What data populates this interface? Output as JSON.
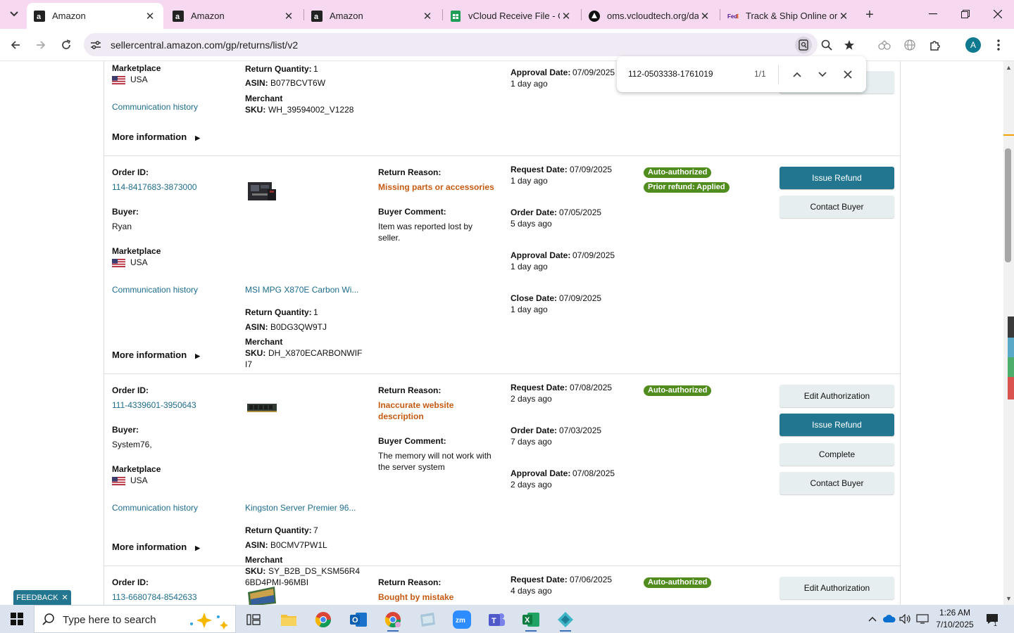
{
  "browser": {
    "tabs": [
      {
        "title": "Amazon",
        "active": true,
        "icon": "amazon-icon"
      },
      {
        "title": "Amazon",
        "active": false,
        "icon": "amazon-icon"
      },
      {
        "title": "Amazon",
        "active": false,
        "icon": "amazon-icon"
      },
      {
        "title": "vCloud Receive File - Go",
        "active": false,
        "icon": "sheets-icon"
      },
      {
        "title": "oms.vcloudtech.org/das",
        "active": false,
        "icon": "oms-icon"
      },
      {
        "title": "Track & Ship Online or",
        "active": false,
        "icon": "fedex-icon"
      }
    ],
    "url": "sellercentral.amazon.com/gp/returns/list/v2",
    "profile_initial": "A"
  },
  "find_bar": {
    "query": "112-0503338-1761019",
    "count": "1/1"
  },
  "labels": {
    "order_id": "Order ID:",
    "buyer": "Buyer:",
    "marketplace": "Marketplace",
    "communication_history": "Communication history",
    "more_information": "More information",
    "return_quantity": "Return Quantity:",
    "asin": "ASIN:",
    "merchant": "Merchant",
    "sku": "SKU:",
    "return_reason": "Return Reason:",
    "buyer_comment": "Buyer Comment:",
    "request_date": "Request Date:",
    "order_date": "Order Date:",
    "approval_date": "Approval Date:",
    "close_date": "Close Date:"
  },
  "returns": [
    {
      "marketplace": "USA",
      "return_quantity": "1",
      "asin": "B077BCVT6W",
      "sku_line1": "WH_39594002_V1228",
      "approval_date": "07/09/2025",
      "approval_ago": "1 day ago"
    },
    {
      "order_id": "114-8417683-3873000",
      "buyer": "Ryan",
      "marketplace": "USA",
      "product": "MSI MPG X870E Carbon Wi...",
      "return_quantity": "1",
      "asin": "B0DG3QW9TJ",
      "sku_line1": "DH_X870ECARBONWIF",
      "sku_line2": "I7",
      "reason": "Missing parts or accessories",
      "comment_line1": "Item was reported lost by",
      "comment_line2": "seller.",
      "request_date": "07/09/2025",
      "request_ago": "1 day ago",
      "order_date": "07/05/2025",
      "order_ago": "5 days ago",
      "approval_date": "07/09/2025",
      "approval_ago": "1 day ago",
      "close_date": "07/09/2025",
      "close_ago": "1 day ago",
      "badges": [
        "Auto-authorized",
        "Prior refund: Applied"
      ],
      "actions": [
        "Issue Refund",
        "Contact Buyer"
      ]
    },
    {
      "order_id": "111-4339601-3950643",
      "buyer": "System76,",
      "marketplace": "USA",
      "product": "Kingston Server Premier 96...",
      "return_quantity": "7",
      "asin": "B0CMV7PW1L",
      "sku_line1": "SY_B2B_DS_KSM56R4",
      "sku_line2": "6BD4PMI-96MBI",
      "reason_line1": "Inaccurate website",
      "reason_line2": "description",
      "comment_line1": "The memory will not work with",
      "comment_line2": "the server system",
      "request_date": "07/08/2025",
      "request_ago": "2 days ago",
      "order_date": "07/03/2025",
      "order_ago": "7 days ago",
      "approval_date": "07/08/2025",
      "approval_ago": "2 days ago",
      "badges": [
        "Auto-authorized"
      ],
      "actions": [
        "Edit Authorization",
        "Issue Refund",
        "Complete",
        "Contact Buyer"
      ]
    },
    {
      "order_id": "113-6680784-8542633",
      "reason": "Bought by mistake",
      "request_date": "07/06/2025",
      "request_ago": "4 days ago",
      "badges": [
        "Auto-authorized"
      ],
      "actions": [
        "Edit Authorization"
      ]
    }
  ],
  "feedback": {
    "label": "FEEDBACK",
    "close": "✕"
  },
  "taskbar": {
    "search_placeholder": "Type here to search",
    "time": "1:26 AM",
    "date": "7/10/2025",
    "notification_count": "1"
  },
  "colors": {
    "tabbar": "#f6d9f0",
    "primary_button": "#23768f",
    "secondary_button": "#e6eef0",
    "badge": "#508c1e",
    "reason": "#c55a11",
    "link": "#1f6d8c"
  }
}
